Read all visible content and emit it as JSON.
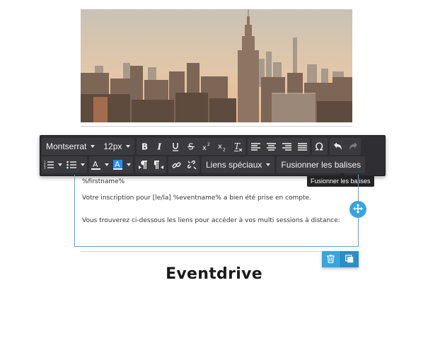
{
  "toolbar": {
    "font_family": "Montserrat",
    "font_size": "12px",
    "special_links_label": "Liens spéciaux",
    "merge_tags_label": "Fusionner les balises",
    "icons": [
      "bold-icon",
      "italic-icon",
      "underline-icon",
      "strikethrough-icon",
      "superscript-icon",
      "subscript-icon",
      "clear-format-icon",
      "align-left-icon",
      "align-center-icon",
      "align-right-icon",
      "align-justify-icon",
      "special-char-icon",
      "undo-icon",
      "redo-icon",
      "ordered-list-icon",
      "unordered-list-icon",
      "font-color-icon",
      "background-color-icon",
      "ltr-icon",
      "rtl-icon",
      "link-icon",
      "unlink-icon"
    ],
    "accent_color": "#1e90ff"
  },
  "tooltip": {
    "text": "Fusionner les balises"
  },
  "editor": {
    "line1": "%firstname%",
    "line2": "Votre inscription pour [le/la] %eventname% a bien été prise en compte.",
    "line3": "Vous trouverez ci-dessous les liens pour accéder à vos multi sessions à distance:"
  },
  "brand": {
    "name": "Eventdrive"
  },
  "colors": {
    "selection_border": "#4aa8d8",
    "action_blue": "#35a6df",
    "toolbar_bg": "#2f2f33"
  }
}
